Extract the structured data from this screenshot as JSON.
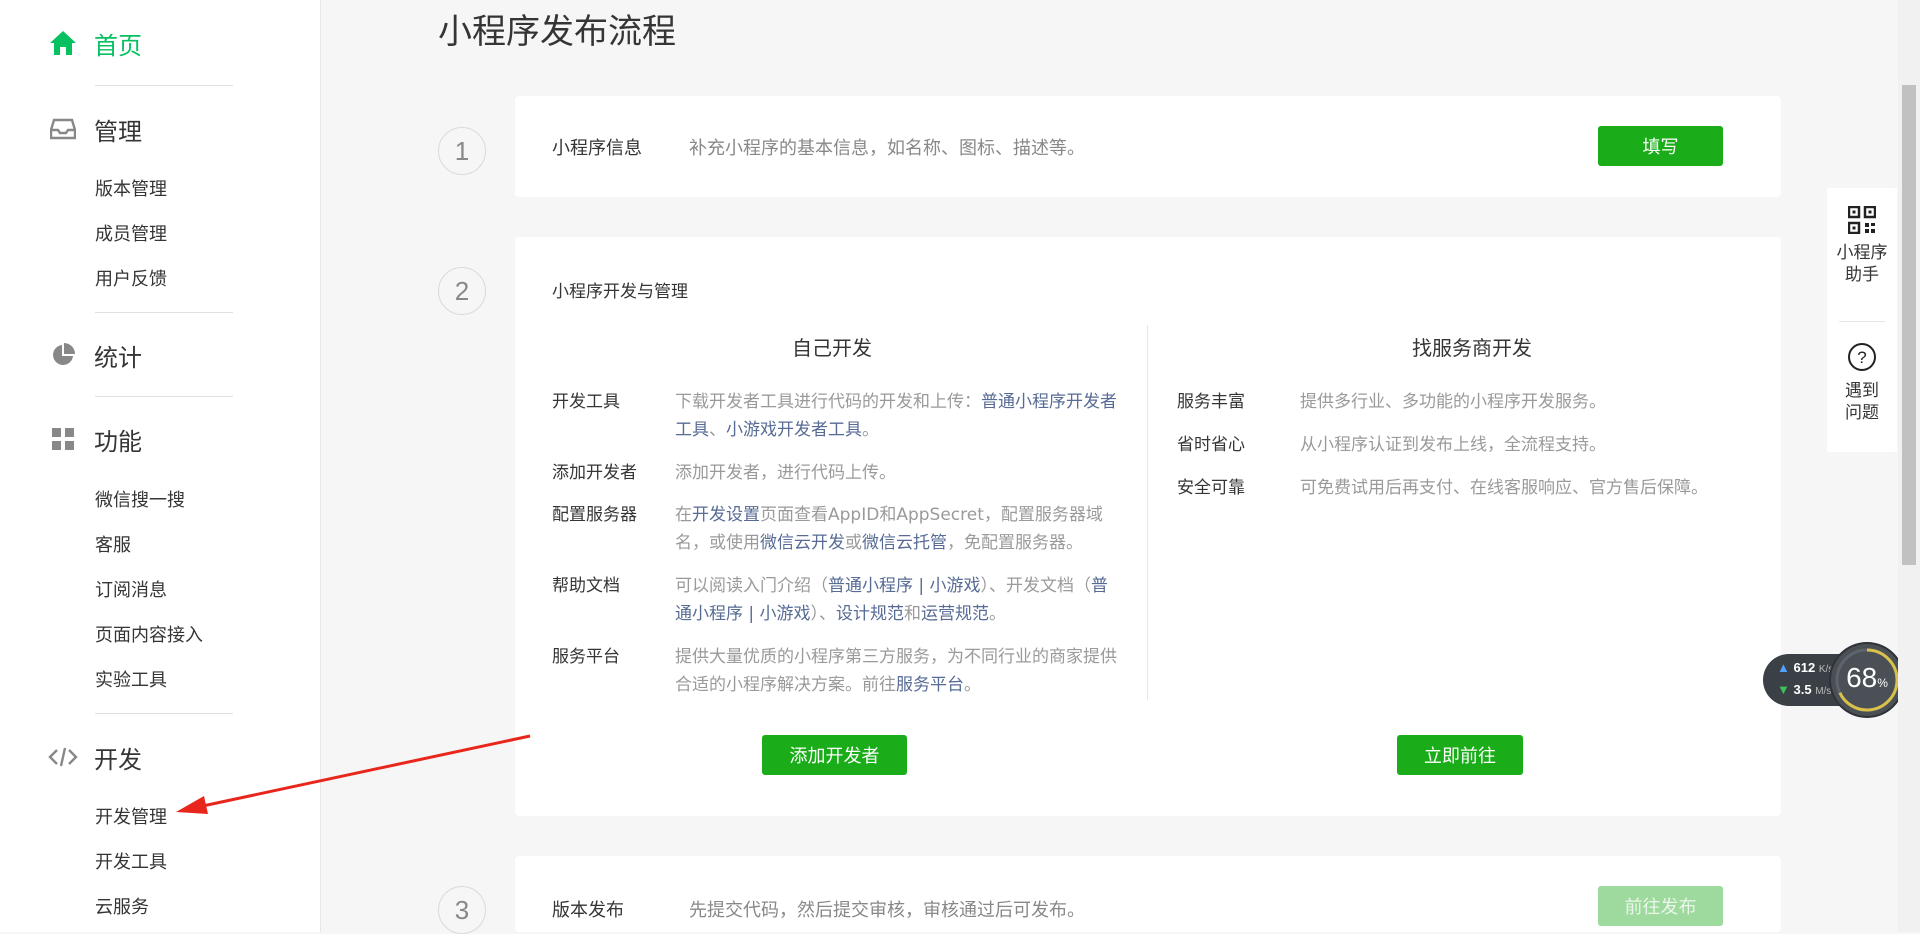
{
  "sidebar": {
    "home": {
      "label": "首页",
      "icon": "home-icon"
    },
    "manage": {
      "label": "管理",
      "icon": "inbox-icon",
      "items": [
        "版本管理",
        "成员管理",
        "用户反馈"
      ]
    },
    "stats": {
      "label": "统计",
      "icon": "pie-chart-icon"
    },
    "features": {
      "label": "功能",
      "icon": "grid-icon",
      "items": [
        "微信搜一搜",
        "客服",
        "订阅消息",
        "页面内容接入",
        "实验工具"
      ]
    },
    "dev": {
      "label": "开发",
      "icon": "code-icon",
      "items": [
        "开发管理",
        "开发工具",
        "云服务"
      ]
    }
  },
  "main": {
    "title": "小程序发布流程",
    "step1": {
      "num": "1",
      "label": "小程序信息",
      "desc": "补充小程序的基本信息，如名称、图标、描述等。",
      "button": "填写"
    },
    "step2": {
      "num": "2",
      "label": "小程序开发与管理",
      "left": {
        "title": "自己开发",
        "rows": {
          "tools": {
            "k": "开发工具",
            "t1": "下载开发者工具进行代码的开发和上传：",
            "l1": "普通小程序开发者工具",
            "t2": "、",
            "l2": "小游戏开发者工具",
            "t3": "。"
          },
          "adddev": {
            "k": "添加开发者",
            "t1": "添加开发者，进行代码上传。"
          },
          "server": {
            "k": "配置服务器",
            "t1": "在",
            "l1": "开发设置",
            "t2": "页面查看AppID和AppSecret，配置服务器域名，或使用",
            "l2": "微信云开发",
            "t3": "或",
            "l3": "微信云托管",
            "t4": "，免配置服务器。"
          },
          "docs": {
            "k": "帮助文档",
            "t1": "可以阅读入门介绍（",
            "l1": "普通小程序 | 小游戏",
            "t2": "）、开发文档（",
            "l2": "普通小程序 | 小游戏",
            "t3": "）、",
            "l3": "设计规范",
            "t4": "和",
            "l4": "运营规范",
            "t5": "。"
          },
          "platform": {
            "k": "服务平台",
            "t1": "提供大量优质的小程序第三方服务，为不同行业的商家提供合适的小程序解决方案。前往",
            "l1": "服务平台",
            "t2": "。"
          }
        },
        "button": "添加开发者"
      },
      "right": {
        "title": "找服务商开发",
        "rows": [
          {
            "k": "服务丰富",
            "v": "提供多行业、多功能的小程序开发服务。"
          },
          {
            "k": "省时省心",
            "v": "从小程序认证到发布上线，全流程支持。"
          },
          {
            "k": "安全可靠",
            "v": "可免费试用后再支付、在线客服响应、官方售后保障。"
          }
        ],
        "button": "立即前往"
      }
    },
    "step3": {
      "num": "3",
      "label": "版本发布",
      "desc": "先提交代码，然后提交审核，审核通过后可发布。",
      "button": "前往发布"
    }
  },
  "float_panel": {
    "assistant": {
      "line1": "小程序",
      "line2": "助手",
      "icon": "qr-code-icon"
    },
    "help": {
      "line1": "遇到",
      "line2": "问题",
      "icon": "question-icon"
    }
  },
  "net_widget": {
    "up": "612",
    "up_unit": "K/s",
    "down": "3.5",
    "down_unit": "M/s",
    "percent": "68",
    "percent_unit": "%"
  },
  "colors": {
    "accent": "#07c160",
    "button": "#1aad19",
    "link": "#576b95",
    "arrow": "#e8261b"
  }
}
